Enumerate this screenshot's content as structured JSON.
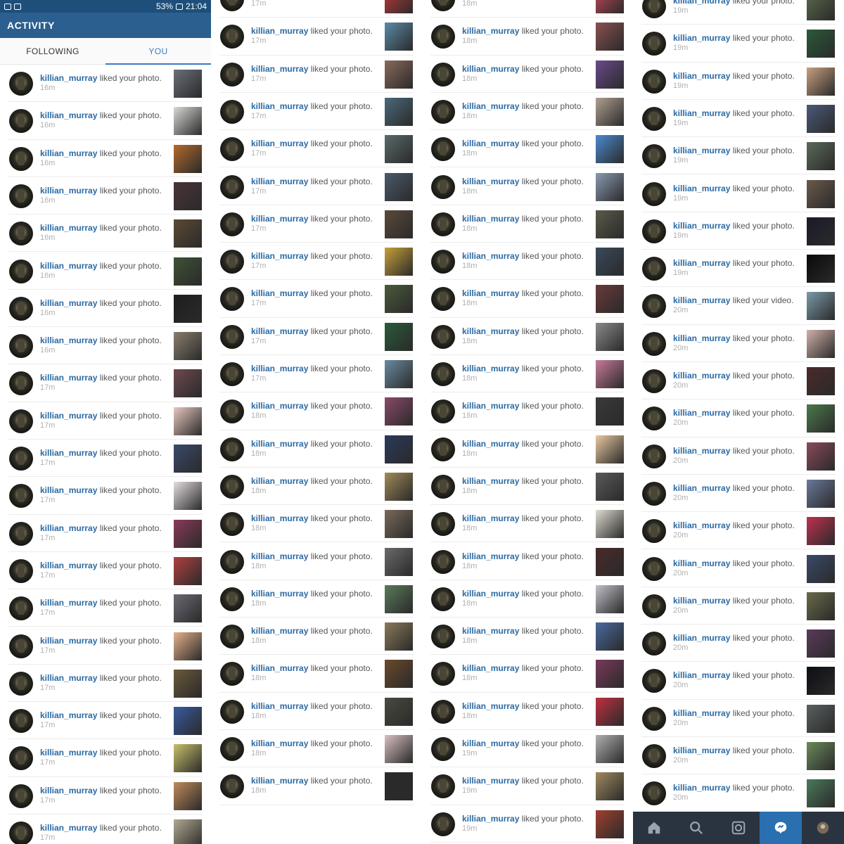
{
  "status_bar": {
    "battery": "53%",
    "time": "21:04"
  },
  "header": {
    "title": "ACTIVITY"
  },
  "tabs": [
    {
      "label": "FOLLOWING",
      "active": false
    },
    {
      "label": "YOU",
      "active": true
    }
  ],
  "bottom_nav": [
    {
      "icon": "home-icon",
      "active": false
    },
    {
      "icon": "search-icon",
      "active": false
    },
    {
      "icon": "camera-icon",
      "active": false
    },
    {
      "icon": "activity-icon",
      "active": true
    },
    {
      "icon": "profile-icon",
      "active": false
    }
  ],
  "activity_columns": [
    [
      {
        "user": "killian_murray",
        "action": "liked your photo.",
        "time": "16m",
        "color": "#6a6f78"
      },
      {
        "user": "killian_murray",
        "action": "liked your photo.",
        "time": "16m",
        "color": "#d8d8d4"
      },
      {
        "user": "killian_murray",
        "action": "liked your photo.",
        "time": "16m",
        "color": "#b36a2a"
      },
      {
        "user": "killian_murray",
        "action": "liked your photo.",
        "time": "16m",
        "color": "#4a3438"
      },
      {
        "user": "killian_murray",
        "action": "liked your photo.",
        "time": "16m",
        "color": "#5c4a34"
      },
      {
        "user": "killian_murray",
        "action": "liked your photo.",
        "time": "16m",
        "color": "#3f5236"
      },
      {
        "user": "killian_murray",
        "action": "liked your photo.",
        "time": "16m",
        "color": "#1e1e1e"
      },
      {
        "user": "killian_murray",
        "action": "liked your photo.",
        "time": "16m",
        "color": "#8a7e6c"
      },
      {
        "user": "killian_murray",
        "action": "liked your photo.",
        "time": "17m",
        "color": "#6e4a4e"
      },
      {
        "user": "killian_murray",
        "action": "liked your photo.",
        "time": "17m",
        "color": "#e8c8c0"
      },
      {
        "user": "killian_murray",
        "action": "liked your photo.",
        "time": "17m",
        "color": "#3a4a6a"
      },
      {
        "user": "killian_murray",
        "action": "liked your photo.",
        "time": "17m",
        "color": "#e4dde0"
      },
      {
        "user": "killian_murray",
        "action": "liked your photo.",
        "time": "17m",
        "color": "#8a3a5a"
      },
      {
        "user": "killian_murray",
        "action": "liked your photo.",
        "time": "17m",
        "color": "#b04040"
      },
      {
        "user": "killian_murray",
        "action": "liked your photo.",
        "time": "17m",
        "color": "#6a6a74"
      },
      {
        "user": "killian_murray",
        "action": "liked your photo.",
        "time": "17m",
        "color": "#e6b08a"
      },
      {
        "user": "killian_murray",
        "action": "liked your photo.",
        "time": "17m",
        "color": "#6a5a3a"
      },
      {
        "user": "killian_murray",
        "action": "liked your photo.",
        "time": "17m",
        "color": "#3a5aa0"
      },
      {
        "user": "killian_murray",
        "action": "liked your photo.",
        "time": "17m",
        "color": "#c8c06a"
      },
      {
        "user": "killian_murray",
        "action": "liked your photo.",
        "time": "17m",
        "color": "#c08a5a"
      },
      {
        "user": "killian_murray",
        "action": "liked your photo.",
        "time": "17m",
        "color": "#b0a890"
      }
    ],
    [
      {
        "user": "killian_murray",
        "action": "liked your photo.",
        "time": "17m",
        "color": "#c83a3a"
      },
      {
        "user": "killian_murray",
        "action": "liked your photo.",
        "time": "17m",
        "color": "#5a8aa8"
      },
      {
        "user": "killian_murray",
        "action": "liked your photo.",
        "time": "17m",
        "color": "#8a6a5a"
      },
      {
        "user": "killian_murray",
        "action": "liked your photo.",
        "time": "17m",
        "color": "#4a6a7a"
      },
      {
        "user": "killian_murray",
        "action": "liked your photo.",
        "time": "17m",
        "color": "#5a6a6a"
      },
      {
        "user": "killian_murray",
        "action": "liked your photo.",
        "time": "17m",
        "color": "#4a5a6a"
      },
      {
        "user": "killian_murray",
        "action": "liked your photo.",
        "time": "17m",
        "color": "#5a4a3a"
      },
      {
        "user": "killian_murray",
        "action": "liked your photo.",
        "time": "17m",
        "color": "#c8a03a"
      },
      {
        "user": "killian_murray",
        "action": "liked your photo.",
        "time": "17m",
        "color": "#4a5a3a"
      },
      {
        "user": "killian_murray",
        "action": "liked your photo.",
        "time": "17m",
        "color": "#2a5a3a"
      },
      {
        "user": "killian_murray",
        "action": "liked your photo.",
        "time": "17m",
        "color": "#6a8aa0"
      },
      {
        "user": "killian_murray",
        "action": "liked your photo.",
        "time": "18m",
        "color": "#8a4a6a"
      },
      {
        "user": "killian_murray",
        "action": "liked your photo.",
        "time": "18m",
        "color": "#2a3a5a"
      },
      {
        "user": "killian_murray",
        "action": "liked your photo.",
        "time": "18m",
        "color": "#a08a5a"
      },
      {
        "user": "killian_murray",
        "action": "liked your photo.",
        "time": "18m",
        "color": "#7a6a5a"
      },
      {
        "user": "killian_murray",
        "action": "liked your photo.",
        "time": "18m",
        "color": "#6a6a6a"
      },
      {
        "user": "killian_murray",
        "action": "liked your photo.",
        "time": "18m",
        "color": "#5a7a5a"
      },
      {
        "user": "killian_murray",
        "action": "liked your photo.",
        "time": "18m",
        "color": "#8a7a5a"
      },
      {
        "user": "killian_murray",
        "action": "liked your photo.",
        "time": "18m",
        "color": "#6a4a2a"
      },
      {
        "user": "killian_murray",
        "action": "liked your photo.",
        "time": "18m",
        "color": "#4a4a40"
      },
      {
        "user": "killian_murray",
        "action": "liked your photo.",
        "time": "18m",
        "color": "#d8c0c0"
      },
      {
        "user": "killian_murray",
        "action": "liked your photo.",
        "time": "18m",
        "color": "#2a2a2a"
      }
    ],
    [
      {
        "user": "killian_murray",
        "action": "liked your photo.",
        "time": "18m",
        "color": "#c84a5a"
      },
      {
        "user": "killian_murray",
        "action": "liked your photo.",
        "time": "18m",
        "color": "#8a5050"
      },
      {
        "user": "killian_murray",
        "action": "liked your photo.",
        "time": "18m",
        "color": "#6a4a8a"
      },
      {
        "user": "killian_murray",
        "action": "liked your photo.",
        "time": "18m",
        "color": "#b0a090"
      },
      {
        "user": "killian_murray",
        "action": "liked your photo.",
        "time": "18m",
        "color": "#4a8ad0"
      },
      {
        "user": "killian_murray",
        "action": "liked your photo.",
        "time": "18m",
        "color": "#8a9ab0"
      },
      {
        "user": "killian_murray",
        "action": "liked your photo.",
        "time": "18m",
        "color": "#5a5a4a"
      },
      {
        "user": "killian_murray",
        "action": "liked your photo.",
        "time": "18m",
        "color": "#3a4a5a"
      },
      {
        "user": "killian_murray",
        "action": "liked your photo.",
        "time": "18m",
        "color": "#6a3a3a"
      },
      {
        "user": "killian_murray",
        "action": "liked your photo.",
        "time": "18m",
        "color": "#8a8a8a"
      },
      {
        "user": "killian_murray",
        "action": "liked your photo.",
        "time": "18m",
        "color": "#c87a9a"
      },
      {
        "user": "killian_murray",
        "action": "liked your photo.",
        "time": "18m",
        "color": "#3a3a3a"
      },
      {
        "user": "killian_murray",
        "action": "liked your photo.",
        "time": "18m",
        "color": "#e8c8a0"
      },
      {
        "user": "killian_murray",
        "action": "liked your photo.",
        "time": "18m",
        "color": "#5a5a5a"
      },
      {
        "user": "killian_murray",
        "action": "liked your photo.",
        "time": "18m",
        "color": "#e0dcd0"
      },
      {
        "user": "killian_murray",
        "action": "liked your photo.",
        "time": "18m",
        "color": "#4a2a2a"
      },
      {
        "user": "killian_murray",
        "action": "liked your photo.",
        "time": "18m",
        "color": "#c0c0c8"
      },
      {
        "user": "killian_murray",
        "action": "liked your photo.",
        "time": "18m",
        "color": "#4a6aa0"
      },
      {
        "user": "killian_murray",
        "action": "liked your photo.",
        "time": "18m",
        "color": "#7a3a5a"
      },
      {
        "user": "killian_murray",
        "action": "liked your photo.",
        "time": "18m",
        "color": "#c03040"
      },
      {
        "user": "killian_murray",
        "action": "liked your photo.",
        "time": "19m",
        "color": "#b0b0b0"
      },
      {
        "user": "killian_murray",
        "action": "liked your photo.",
        "time": "19m",
        "color": "#a08a60"
      },
      {
        "user": "killian_murray",
        "action": "liked your photo.",
        "time": "19m",
        "color": "#a04030"
      }
    ],
    [
      {
        "user": "killian_murray",
        "action": "liked your photo.",
        "time": "19m",
        "color": "#5a6a4a"
      },
      {
        "user": "killian_murray",
        "action": "liked your photo.",
        "time": "19m",
        "color": "#2a5a3a"
      },
      {
        "user": "killian_murray",
        "action": "liked your photo.",
        "time": "19m",
        "color": "#c8a080"
      },
      {
        "user": "killian_murray",
        "action": "liked your photo.",
        "time": "19m",
        "color": "#4a5a7a"
      },
      {
        "user": "killian_murray",
        "action": "liked your photo.",
        "time": "19m",
        "color": "#5a6a5a"
      },
      {
        "user": "killian_murray",
        "action": "liked your photo.",
        "time": "19m",
        "color": "#6a5a4a"
      },
      {
        "user": "killian_murray",
        "action": "liked your photo.",
        "time": "19m",
        "color": "#1a1a2a"
      },
      {
        "user": "killian_murray",
        "action": "liked your photo.",
        "time": "19m",
        "color": "#0a0a0a"
      },
      {
        "user": "killian_murray",
        "action": "liked your video.",
        "time": "20m",
        "color": "#7a9aa8"
      },
      {
        "user": "killian_murray",
        "action": "liked your photo.",
        "time": "20m",
        "color": "#d0b0a8"
      },
      {
        "user": "killian_murray",
        "action": "liked your photo.",
        "time": "20m",
        "color": "#4a2a2a"
      },
      {
        "user": "killian_murray",
        "action": "liked your photo.",
        "time": "20m",
        "color": "#4a7a4a"
      },
      {
        "user": "killian_murray",
        "action": "liked your photo.",
        "time": "20m",
        "color": "#8a4a5a"
      },
      {
        "user": "killian_murray",
        "action": "liked your photo.",
        "time": "20m",
        "color": "#6a7a9a"
      },
      {
        "user": "killian_murray",
        "action": "liked your photo.",
        "time": "20m",
        "color": "#c03050"
      },
      {
        "user": "killian_murray",
        "action": "liked your photo.",
        "time": "20m",
        "color": "#3a4a6a"
      },
      {
        "user": "killian_murray",
        "action": "liked your photo.",
        "time": "20m",
        "color": "#6a6a4a"
      },
      {
        "user": "killian_murray",
        "action": "liked your photo.",
        "time": "20m",
        "color": "#5a3a5a"
      },
      {
        "user": "killian_murray",
        "action": "liked your photo.",
        "time": "20m",
        "color": "#0e0e14"
      },
      {
        "user": "killian_murray",
        "action": "liked your photo.",
        "time": "20m",
        "color": "#5a6060"
      },
      {
        "user": "killian_murray",
        "action": "liked your photo.",
        "time": "20m",
        "color": "#6a8a5a"
      },
      {
        "user": "killian_murray",
        "action": "liked your photo.",
        "time": "20m",
        "color": "#4a7a5a"
      }
    ]
  ]
}
